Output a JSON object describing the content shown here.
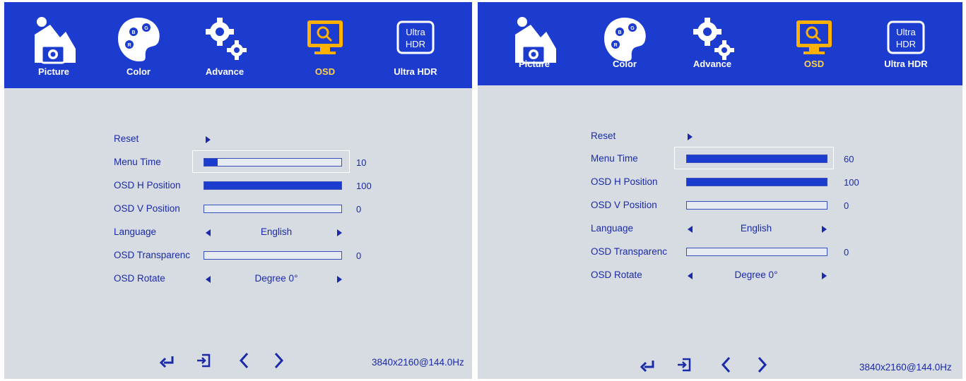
{
  "tabs": [
    "Picture",
    "Color",
    "Advance",
    "OSD",
    "Ultra HDR"
  ],
  "ultra_hdr_icon_text": [
    "Ultra",
    "HDR"
  ],
  "palette_letters": [
    "G",
    "B",
    "R"
  ],
  "menu_labels": {
    "reset": "Reset",
    "menu_time": "Menu Time",
    "osd_h": "OSD H Position",
    "osd_v": "OSD V Position",
    "language": "Language",
    "transparency": "OSD Transparenc",
    "rotate": "OSD Rotate"
  },
  "left": {
    "menu_time": "10",
    "menu_time_level": 0.1,
    "osd_h": "100",
    "osd_h_level": 1.0,
    "osd_v": "0",
    "osd_v_level": 0,
    "language": "English",
    "transparency": "0",
    "transparency_level": 0,
    "rotate": "Degree 0°",
    "resolution": "3840x2160@144.0Hz"
  },
  "right": {
    "menu_time": "60",
    "menu_time_level": 1.0,
    "osd_h": "100",
    "osd_h_level": 1.0,
    "osd_v": "0",
    "osd_v_level": 0,
    "language": "English",
    "transparency": "0",
    "transparency_level": 0,
    "rotate": "Degree 0°",
    "resolution": "3840x2160@144.0Hz"
  },
  "footer_icons": [
    "enter-icon",
    "exit-icon",
    "chevron-left-icon",
    "chevron-right-icon"
  ],
  "colors": {
    "bar_blue": "#1c3ccf",
    "text_blue": "#1a2aa8",
    "active_tab": "#ffb000",
    "background": "#d7dce3"
  }
}
